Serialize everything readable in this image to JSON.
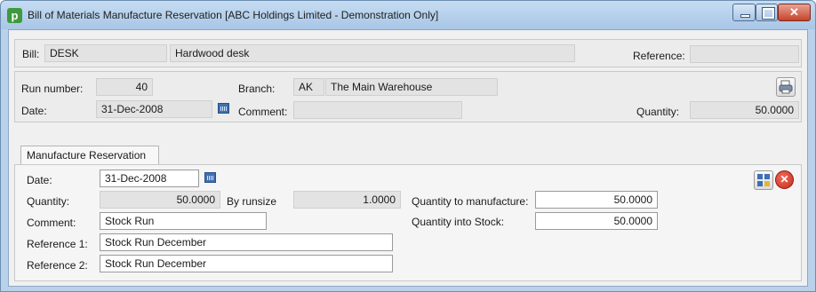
{
  "window": {
    "title": "Bill of Materials Manufacture Reservation [ABC Holdings Limited - Demonstration Only]",
    "app_icon_letter": "p"
  },
  "header": {
    "bill_label": "Bill:",
    "bill_code": "DESK",
    "bill_description": "Hardwood desk",
    "reference_label": "Reference:",
    "reference_value": ""
  },
  "details": {
    "run_number_label": "Run number:",
    "run_number": "40",
    "branch_label": "Branch:",
    "branch_code": "AK",
    "branch_name": "The Main Warehouse",
    "date_label": "Date:",
    "date": "31-Dec-2008",
    "comment_label": "Comment:",
    "comment": "",
    "quantity_label": "Quantity:",
    "quantity": "50.0000"
  },
  "tab": {
    "label": "Manufacture Reservation"
  },
  "reservation": {
    "date_label": "Date:",
    "date": "31-Dec-2008",
    "quantity_label": "Quantity:",
    "quantity": "50.0000",
    "by_runsize_label": "By runsize",
    "by_runsize": "1.0000",
    "qty_to_manufacture_label": "Quantity to manufacture:",
    "qty_to_manufacture": "50.0000",
    "comment_label": "Comment:",
    "comment": "Stock Run",
    "qty_into_stock_label": "Quantity into Stock:",
    "qty_into_stock": "50.0000",
    "reference1_label": "Reference 1:",
    "reference1": "Stock Run December",
    "reference2_label": "Reference 2:",
    "reference2": "Stock Run December"
  },
  "colors": {
    "titlebar": "#b9d1ea",
    "form_background": "#f0f0f0",
    "close_button": "#c7442c"
  }
}
